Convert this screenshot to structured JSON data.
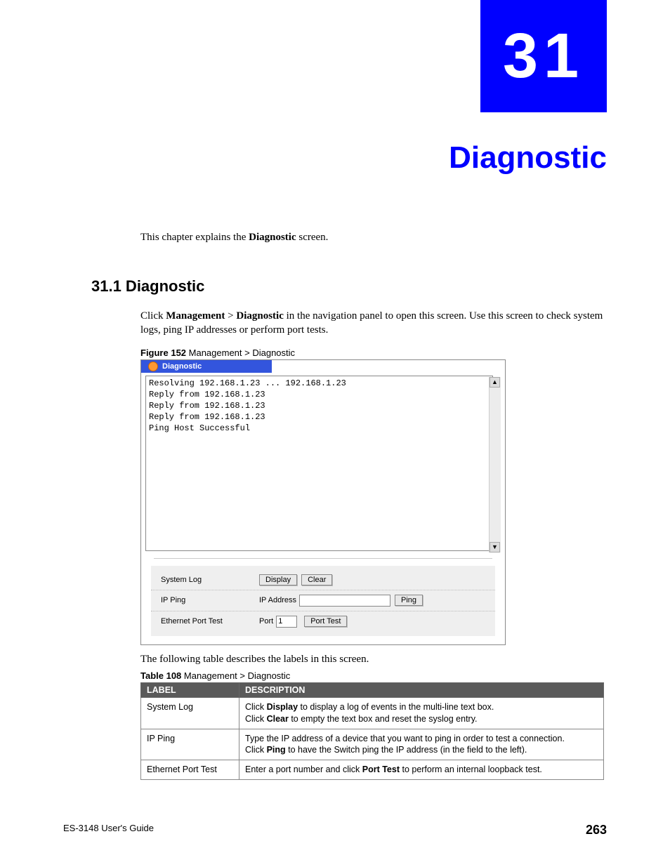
{
  "chapter": {
    "number": "31",
    "title": "Diagnostic"
  },
  "intro": {
    "prefix": "This chapter explains the ",
    "bold": "Diagnostic",
    "suffix": " screen."
  },
  "section": {
    "heading": "31.1  Diagnostic",
    "para": {
      "t1": "Click ",
      "b1": "Management",
      "t2": " > ",
      "b2": "Diagnostic",
      "t3": " in the navigation panel to open this screen. Use this screen to check system logs, ping IP addresses or perform port tests."
    }
  },
  "figure": {
    "label": "Figure 152",
    "caption": "   Management > Diagnostic",
    "panel_title": "Diagnostic",
    "log": "Resolving 192.168.1.23 ... 192.168.1.23\nReply from 192.168.1.23\nReply from 192.168.1.23\nReply from 192.168.1.23\nPing Host Successful",
    "rows": {
      "syslog": {
        "label": "System Log",
        "btn_display": "Display",
        "btn_clear": "Clear"
      },
      "ipping": {
        "label": "IP Ping",
        "field_label": "IP Address",
        "value": "",
        "btn_ping": "Ping"
      },
      "porttest": {
        "label": "Ethernet Port Test",
        "field_label": "Port",
        "value": "1",
        "btn_test": "Port Test"
      }
    }
  },
  "after_figure": "The following table describes the labels in this screen.",
  "table": {
    "label": "Table 108",
    "caption": "   Management > Diagnostic",
    "headers": {
      "c1": "LABEL",
      "c2": "DESCRIPTION"
    },
    "rows": [
      {
        "label": "System Log",
        "desc": {
          "l1a": "Click ",
          "l1b": "Display",
          "l1c": " to display a log of events in the multi-line text box.",
          "l2a": "Click ",
          "l2b": "Clear",
          "l2c": " to empty the text box and reset the syslog entry."
        }
      },
      {
        "label": "IP Ping",
        "desc": {
          "l1": "Type the IP address of a device that you want to ping in order to test a connection.",
          "l2a": "Click ",
          "l2b": "Ping",
          "l2c": " to have the Switch ping the IP address (in the field to the left)."
        }
      },
      {
        "label": "Ethernet Port Test",
        "desc": {
          "l1a": "Enter a port number and click ",
          "l1b": "Port Test",
          "l1c": " to perform an internal loopback test."
        }
      }
    ]
  },
  "footer": {
    "guide": "ES-3148 User's Guide",
    "page": "263"
  }
}
